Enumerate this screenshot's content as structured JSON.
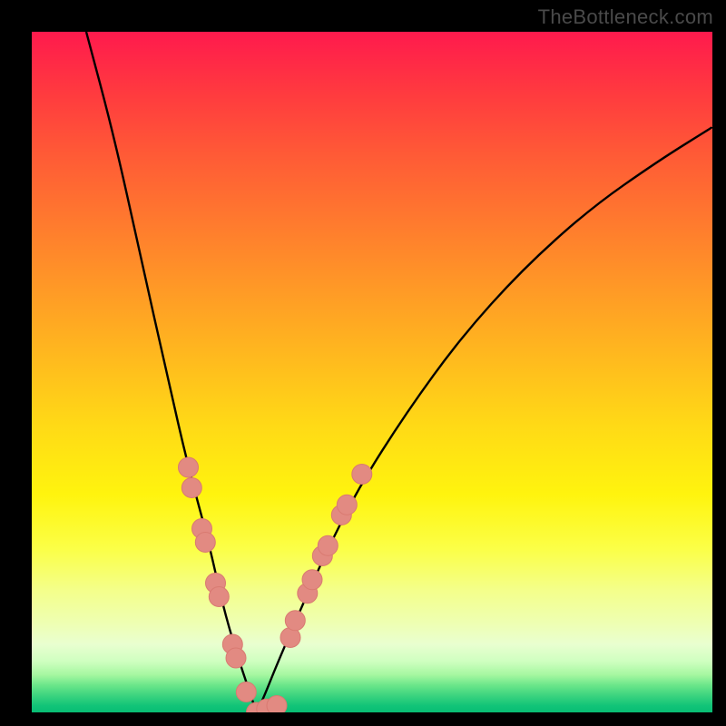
{
  "watermark": "TheBottleneck.com",
  "colors": {
    "frame": "#000000",
    "curve": "#000000",
    "marker_fill": "#e28a82",
    "marker_stroke": "#d97a71"
  },
  "chart_data": {
    "type": "line",
    "title": "",
    "xlabel": "",
    "ylabel": "",
    "xlim": [
      0,
      100
    ],
    "ylim": [
      0,
      100
    ],
    "grid": false,
    "legend": false,
    "background": "red-yellow-green vertical gradient",
    "description": "V-shaped bottleneck curve with minimum near x≈33; steep left branch, shallower right branch. Salmon markers clustered along both branches in the lower third.",
    "minimum": {
      "x": 33,
      "y": 0
    },
    "curve_samples": {
      "x": [
        8,
        12,
        16,
        20,
        23,
        26,
        28,
        30,
        32,
        33,
        34,
        36,
        39,
        43,
        48,
        55,
        63,
        72,
        82,
        92,
        100
      ],
      "y_pct": [
        100,
        85,
        67,
        49,
        36,
        25,
        16,
        9,
        3,
        0,
        2,
        7,
        14,
        23,
        33,
        44,
        55,
        65,
        74,
        81,
        86
      ]
    },
    "markers": [
      {
        "x": 23.0,
        "y_pct": 36
      },
      {
        "x": 23.5,
        "y_pct": 33
      },
      {
        "x": 25.0,
        "y_pct": 27
      },
      {
        "x": 25.5,
        "y_pct": 25
      },
      {
        "x": 27.0,
        "y_pct": 19
      },
      {
        "x": 27.5,
        "y_pct": 17
      },
      {
        "x": 29.5,
        "y_pct": 10
      },
      {
        "x": 30.0,
        "y_pct": 8
      },
      {
        "x": 31.5,
        "y_pct": 3
      },
      {
        "x": 33.0,
        "y_pct": 0
      },
      {
        "x": 34.5,
        "y_pct": 0.5
      },
      {
        "x": 36.0,
        "y_pct": 1
      },
      {
        "x": 38.0,
        "y_pct": 11
      },
      {
        "x": 38.7,
        "y_pct": 13.5
      },
      {
        "x": 40.5,
        "y_pct": 17.5
      },
      {
        "x": 41.2,
        "y_pct": 19.5
      },
      {
        "x": 42.7,
        "y_pct": 23
      },
      {
        "x": 43.5,
        "y_pct": 24.5
      },
      {
        "x": 45.5,
        "y_pct": 29
      },
      {
        "x": 46.3,
        "y_pct": 30.5
      },
      {
        "x": 48.5,
        "y_pct": 35
      }
    ]
  }
}
